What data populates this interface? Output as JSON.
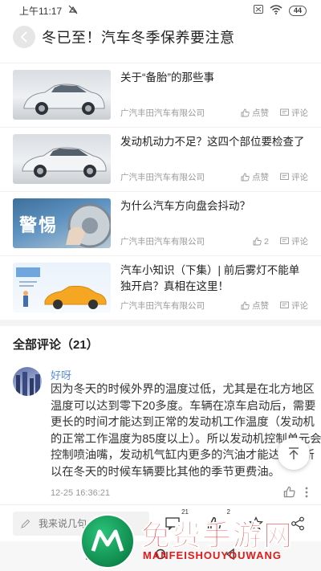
{
  "status_bar": {
    "time": "上午11:17",
    "battery": "44"
  },
  "header": {
    "title": "冬已至！汽车冬季保养要注意"
  },
  "articles": [
    {
      "title": "关于“备胎”的那些事",
      "source": "广汽丰田汽车有限公司",
      "like_label": "点赞",
      "comment_label": "评论"
    },
    {
      "title": "发动机动力不足？这四个部位要检查了",
      "source": "广汽丰田汽车有限公司",
      "like_label": "点赞",
      "comment_label": "评论"
    },
    {
      "title": "为什么汽车方向盘会抖动？",
      "source": "广汽丰田汽车有限公司",
      "like_count": "2",
      "comment_label": "评论",
      "thumb_text": "警惕"
    },
    {
      "title": "汽车小知识（下集）| 前后雾灯不能单独开启？真相在这里！",
      "source": "广汽丰田汽车有限公司",
      "like_label": "点赞",
      "comment_label": "评论"
    }
  ],
  "comments_section": {
    "heading": "全部评论（21）",
    "comment": {
      "user": "好呀",
      "body": "因为冬天的时候外界的温度过低，尤其是在北方地区温度可以达到零下20多度。车辆在凉车启动后，需要更长的时间才能达到正常的发动机工作温度（发动机的正常工作温度为85度以上）。所以发动机控制单元会控制喷油嘴，发动机气缸内更多的汽油才能达到。所以在冬天的时候车辆要比其他的季节更费油。",
      "time": "12-25 16:36:21"
    }
  },
  "bottom_bar": {
    "input_placeholder": "我来说几句",
    "comment_count": "21",
    "like_count": "2"
  },
  "watermark": {
    "text": "免费手游网",
    "subtext": "MANFEISHOUYOUWANG"
  },
  "colors": {
    "username": "#5d8ed8",
    "watermark_red": "#e11a1a",
    "watermark_green": "#0f8a4d"
  }
}
